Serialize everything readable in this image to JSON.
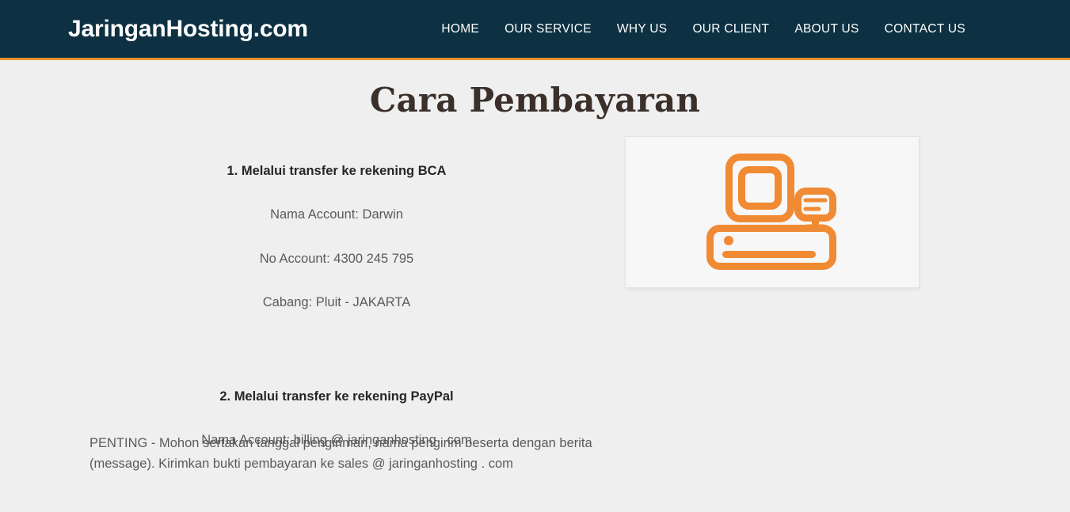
{
  "header": {
    "logo": "JaringanHosting.com",
    "nav": [
      {
        "label": "HOME",
        "name": "nav-link-home"
      },
      {
        "label": "OUR SERVICE",
        "name": "nav-link-our-service"
      },
      {
        "label": "WHY US",
        "name": "nav-link-why-us"
      },
      {
        "label": "OUR CLIENT",
        "name": "nav-link-our-client"
      },
      {
        "label": "ABOUT US",
        "name": "nav-link-about-us"
      },
      {
        "label": "CONTACT US",
        "name": "nav-link-contact-us"
      }
    ]
  },
  "page": {
    "title": "Cara Pembayaran"
  },
  "methods": [
    {
      "heading": "1. Melalui transfer ke rekening BCA",
      "lines": [
        "Nama Account: Darwin",
        "No Account: 4300 245 795",
        "Cabang: Pluit - JAKARTA"
      ]
    },
    {
      "heading": "2. Melalui transfer ke rekening PayPal",
      "lines": [
        "Nama Account: billing @ jaringanhosting . com"
      ]
    }
  ],
  "note": "PENTING - Mohon sertakan tanggal pengiriman, nama pengirim beserta dengan berita (message). Kirimkan bukti pembayaran ke sales @ jaringanhosting . com",
  "illustration": {
    "icon_name": "cash-register-icon",
    "accent_color": "#f08a33"
  },
  "colors": {
    "header_background": "#0d3142",
    "header_accent_border": "#e8922e",
    "page_background": "#efefef",
    "title_text": "#3b2f2a",
    "body_text": "#5a5a5a",
    "heading_text": "#262626",
    "card_background": "#f7f7f7",
    "card_border": "#e4e4e4"
  }
}
